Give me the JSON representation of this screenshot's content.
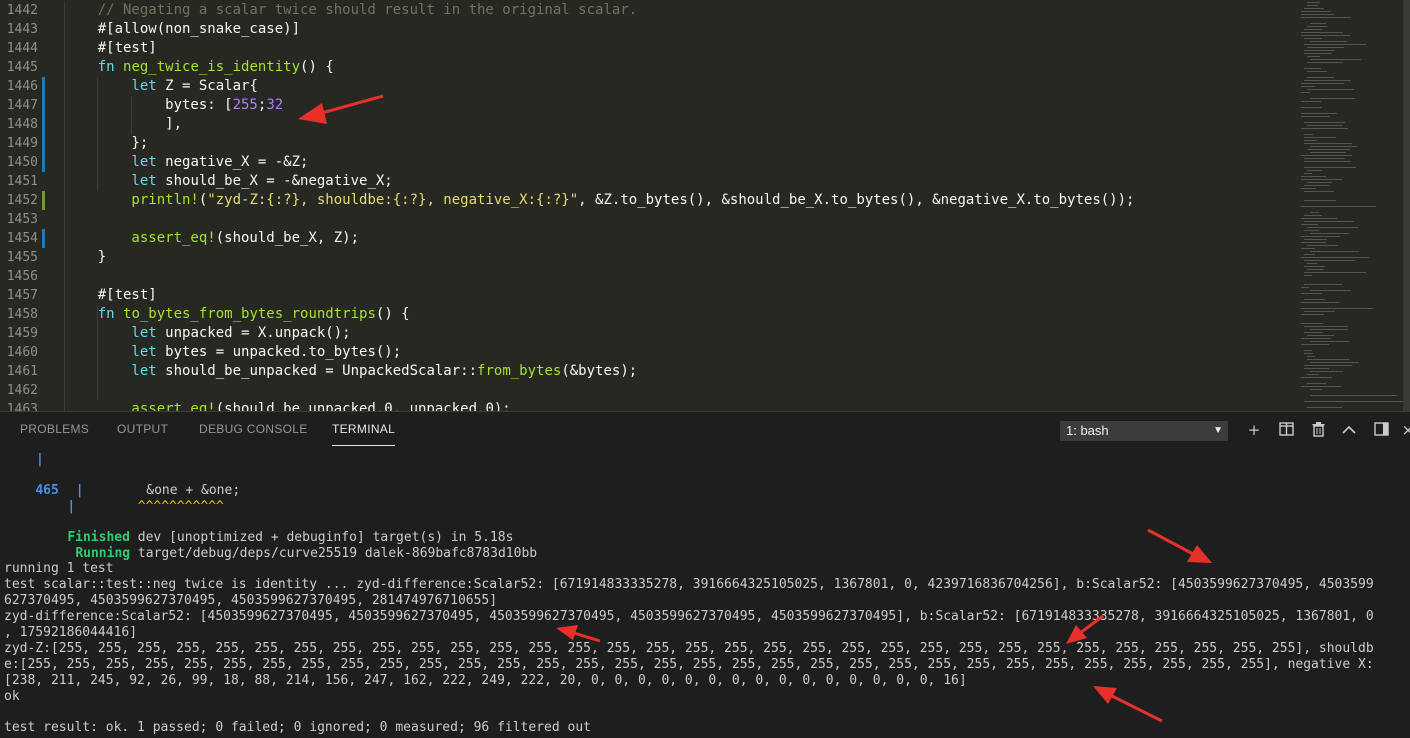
{
  "editor": {
    "lines": [
      {
        "n": "1442",
        "tokens": [
          [
            "cm",
            "    // Negating a scalar twice should result in the original scalar."
          ]
        ]
      },
      {
        "n": "1443",
        "tokens": [
          [
            "ty",
            "    #[allow(non_snake_case)]"
          ]
        ]
      },
      {
        "n": "1444",
        "tokens": [
          [
            "ty",
            "    #[test]"
          ]
        ]
      },
      {
        "n": "1445",
        "tokens": [
          [
            "kw",
            "    fn "
          ],
          [
            "fn",
            "neg_twice_is_identity"
          ],
          [
            "ty",
            "() {"
          ]
        ]
      },
      {
        "n": "1446",
        "tokens": [
          [
            "kw",
            "        let "
          ],
          [
            "ty",
            "Z = Scalar{"
          ]
        ]
      },
      {
        "n": "1447",
        "tokens": [
          [
            "ty",
            "            bytes: ["
          ],
          [
            "nm",
            "255"
          ],
          [
            "ty",
            ";"
          ],
          [
            "nm",
            "32"
          ]
        ]
      },
      {
        "n": "1448",
        "tokens": [
          [
            "ty",
            "            ],"
          ]
        ]
      },
      {
        "n": "1449",
        "tokens": [
          [
            "ty",
            "        };"
          ]
        ]
      },
      {
        "n": "1450",
        "tokens": [
          [
            "kw",
            "        let "
          ],
          [
            "ty",
            "negative_X = -&Z;"
          ]
        ]
      },
      {
        "n": "1451",
        "tokens": [
          [
            "kw",
            "        let "
          ],
          [
            "ty",
            "should_be_X = -&negative_X;"
          ]
        ]
      },
      {
        "n": "1452",
        "tokens": [
          [
            "mc",
            "        println!"
          ],
          [
            "ty",
            "("
          ],
          [
            "st",
            "\"zyd-Z:{:?}, shouldbe:{:?}, negative_X:{:?}\""
          ],
          [
            "ty",
            ", &Z.to_bytes(), &should_be_X.to_bytes(), &negative_X.to_bytes());"
          ]
        ]
      },
      {
        "n": "1453",
        "tokens": [
          [
            "ty",
            ""
          ]
        ]
      },
      {
        "n": "1454",
        "tokens": [
          [
            "mc",
            "        assert_eq!"
          ],
          [
            "ty",
            "(should_be_X, Z);"
          ]
        ]
      },
      {
        "n": "1455",
        "tokens": [
          [
            "ty",
            "    }"
          ]
        ]
      },
      {
        "n": "1456",
        "tokens": [
          [
            "ty",
            ""
          ]
        ]
      },
      {
        "n": "1457",
        "tokens": [
          [
            "ty",
            "    #[test]"
          ]
        ]
      },
      {
        "n": "1458",
        "tokens": [
          [
            "kw",
            "    fn "
          ],
          [
            "fn",
            "to_bytes_from_bytes_roundtrips"
          ],
          [
            "ty",
            "() {"
          ]
        ]
      },
      {
        "n": "1459",
        "tokens": [
          [
            "kw",
            "        let "
          ],
          [
            "ty",
            "unpacked = X.unpack();"
          ]
        ]
      },
      {
        "n": "1460",
        "tokens": [
          [
            "kw",
            "        let "
          ],
          [
            "ty",
            "bytes = unpacked.to_bytes();"
          ]
        ]
      },
      {
        "n": "1461",
        "tokens": [
          [
            "kw",
            "        let "
          ],
          [
            "ty",
            "should_be_unpacked = UnpackedScalar::"
          ],
          [
            "fn",
            "from_bytes"
          ],
          [
            "ty",
            "(&bytes);"
          ]
        ]
      },
      {
        "n": "1462",
        "tokens": [
          [
            "ty",
            ""
          ]
        ]
      },
      {
        "n": "1463",
        "tokens": [
          [
            "mc",
            "        assert_eq!"
          ],
          [
            "ty",
            "(should_be_unpacked.0, unpacked.0);"
          ]
        ]
      }
    ]
  },
  "panel": {
    "tabs": [
      "PROBLEMS",
      "OUTPUT",
      "DEBUG CONSOLE",
      "TERMINAL"
    ],
    "active_tab": "TERMINAL",
    "terminal_select": "1: bash"
  },
  "terminal": {
    "pipe": "|",
    "line_no": "465",
    "code_line": "        &one + &one;",
    "squiggle": "        ^^^^^^^^^^^",
    "finished_word": "Finished",
    "finished_rest": " dev [unoptimized + debuginfo] target(s) in 5.18s",
    "running_word": "Running",
    "running_rest": " target/debug/deps/curve25519 dalek-869bafc8783d10bb",
    "running_tests": "running 1 test",
    "out1": "test scalar::test::neg twice is identity ... zyd-difference:Scalar52: [671914833335278, 3916664325105025, 1367801, 0, 4239716836704256], b:Scalar52: [4503599627370495, 4503599",
    "out2": "627370495, 4503599627370495, 4503599627370495, 281474976710655]",
    "out3": "zyd-difference:Scalar52: [4503599627370495, 4503599627370495, 4503599627370495, 4503599627370495, 4503599627370495], b:Scalar52: [671914833335278, 3916664325105025, 1367801, 0",
    "out4": ", 17592186044416]",
    "out5": "zyd-Z:[255, 255, 255, 255, 255, 255, 255, 255, 255, 255, 255, 255, 255, 255, 255, 255, 255, 255, 255, 255, 255, 255, 255, 255, 255, 255, 255, 255, 255, 255, 255, 255], shouldb",
    "out6": "e:[255, 255, 255, 255, 255, 255, 255, 255, 255, 255, 255, 255, 255, 255, 255, 255, 255, 255, 255, 255, 255, 255, 255, 255, 255, 255, 255, 255, 255, 255, 255, 255], negative X:",
    "out7": "[238, 211, 245, 92, 26, 99, 18, 88, 214, 156, 247, 162, 222, 249, 222, 20, 0, 0, 0, 0, 0, 0, 0, 0, 0, 0, 0, 0, 0, 0, 0, 16]",
    "ok": "ok",
    "result": "test result: ok. 1 passed; 0 failed; 0 ignored; 0 measured; 96 filtered out"
  },
  "colors": {
    "editor_bg": "#272822",
    "terminal_bg": "#1e1e1e",
    "arrow": "#e8302a",
    "finished": "#2ecc71",
    "line_no": "#4b8fe8"
  }
}
